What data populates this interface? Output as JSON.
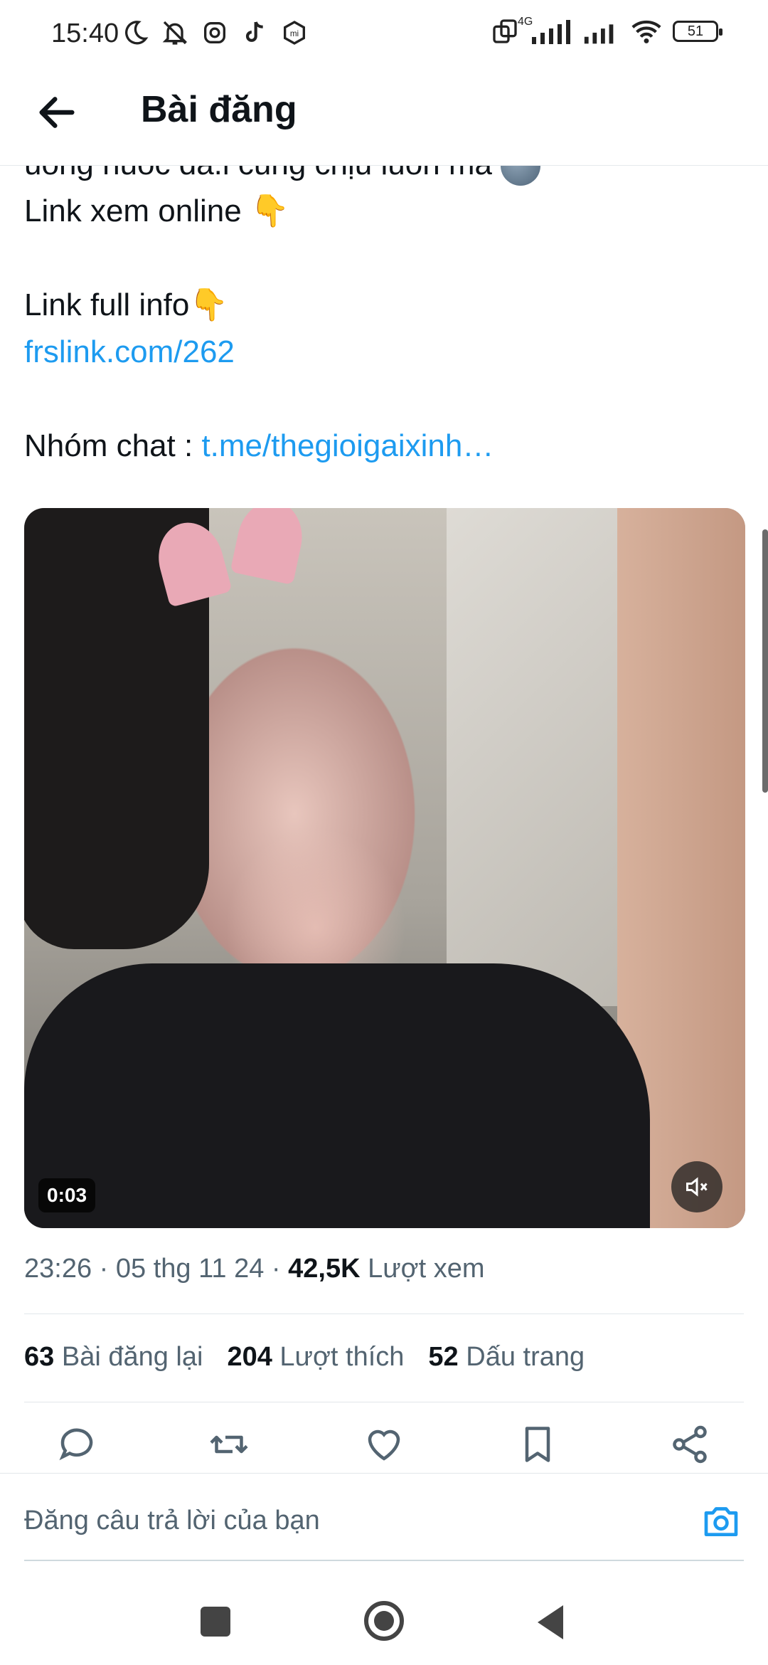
{
  "status_bar": {
    "time": "15:40",
    "network": "4G",
    "battery": "51",
    "icons": [
      "moon-icon",
      "bell-off-icon",
      "instagram-icon",
      "tiktok-icon",
      "mi-icon",
      "screen-rotate-icon",
      "signal-icon",
      "signal-icon",
      "wifi-icon",
      "battery-icon"
    ]
  },
  "header": {
    "title": "Bài đăng"
  },
  "post": {
    "line1": "uong nuoc da.i cung chịu luon ma",
    "line2": "Link xem online",
    "line3": "Link full info",
    "link1": "frslink.com/262",
    "line4_label": "Nhóm chat :",
    "link2": "t.me/thegioigaixinh…",
    "emoji_point": "👇"
  },
  "media": {
    "duration": "0:03"
  },
  "meta": {
    "time": "23:26 · 05 thg 11 24 · ",
    "views_count": "42,5K",
    "views_label": "Lượt xem"
  },
  "stats": {
    "reposts_count": "63",
    "reposts_label": "Bài đăng lại",
    "likes_count": "204",
    "likes_label": "Lượt thích",
    "bookmarks_count": "52",
    "bookmarks_label": "Dấu trang"
  },
  "reply": {
    "placeholder": "Đăng câu trả lời của bạn"
  },
  "colors": {
    "link": "#1d9bf0",
    "text": "#0f1419",
    "secondary": "#536471"
  }
}
